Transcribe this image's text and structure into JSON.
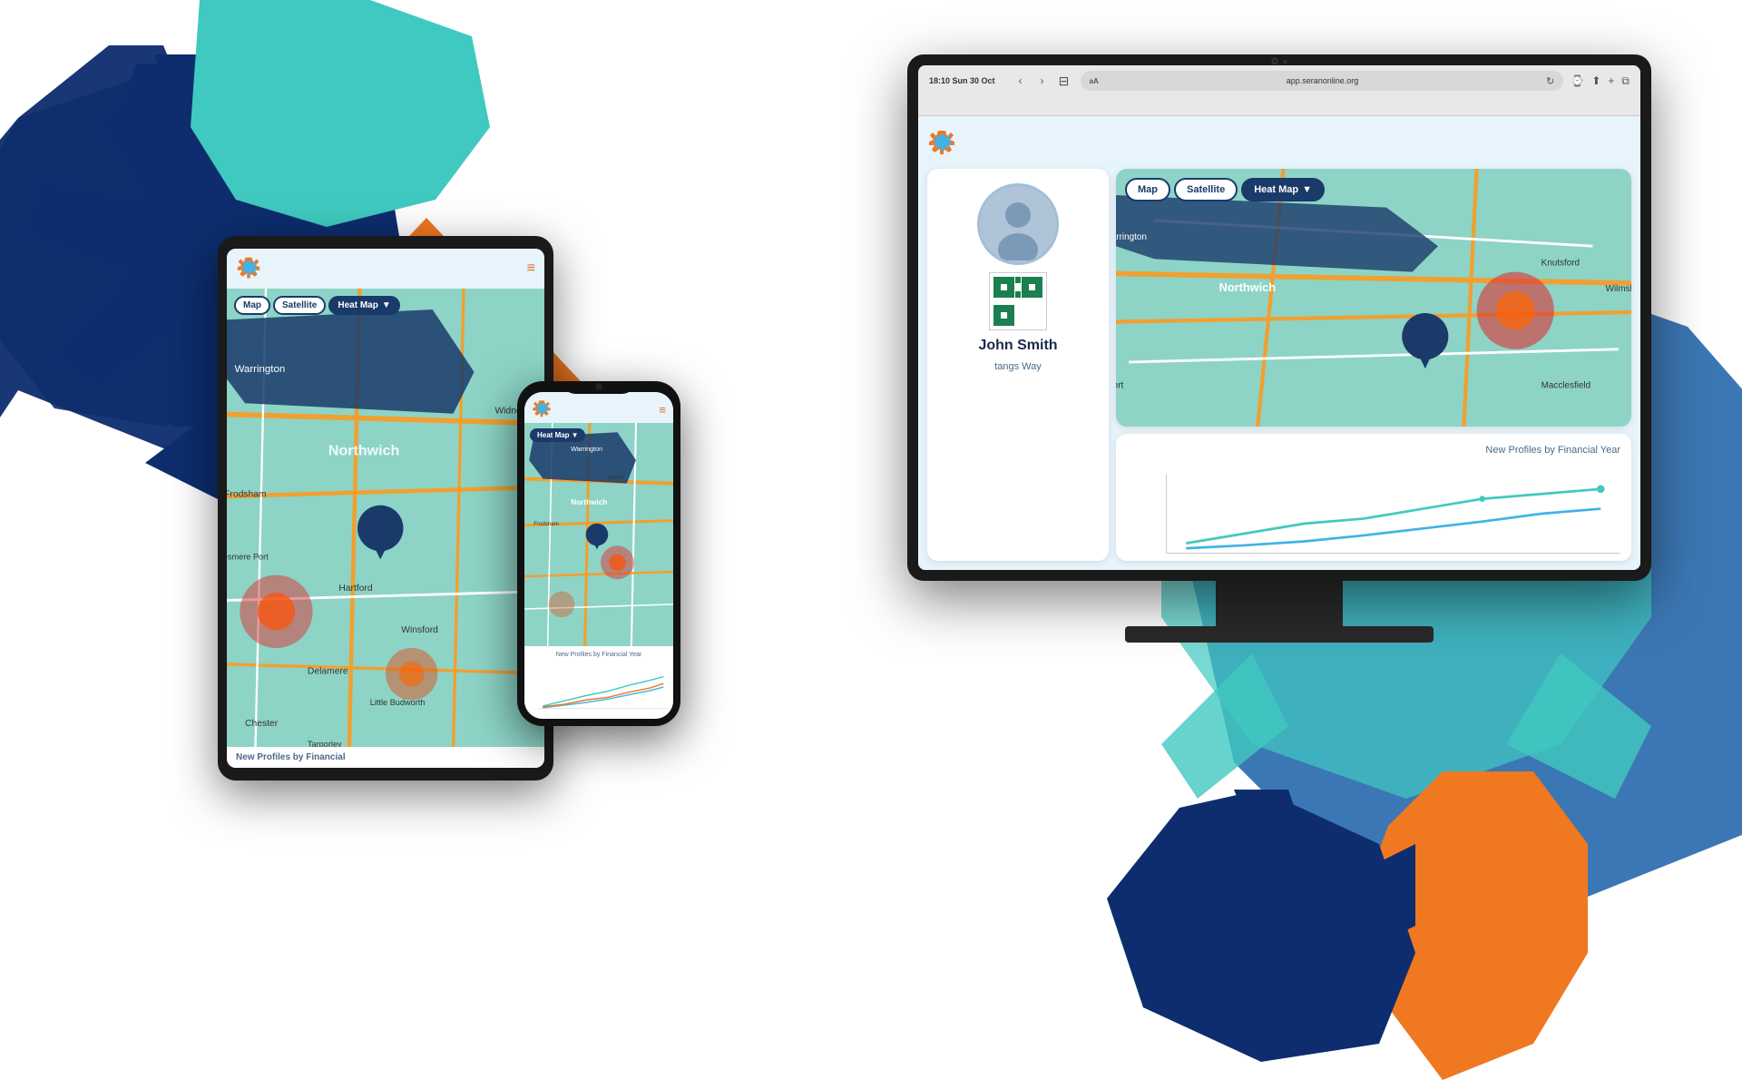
{
  "app": {
    "name": "Seran Online",
    "url": "app.seranonline.org",
    "time": "18:10",
    "date": "Sun 30 Oct"
  },
  "browser": {
    "url": "app.seranonline.org",
    "time_label": "18:10 Sun 30 Oct",
    "aa_label": "aA",
    "reload_symbol": "↻",
    "nav_back": "‹",
    "nav_forward": "›",
    "reader_icon": "□"
  },
  "profile": {
    "name": "John Smith",
    "address": "tangs Way"
  },
  "map": {
    "btn_map": "Map",
    "btn_satellite": "Satellite",
    "btn_heatmap": "Heat Map",
    "dropdown_arrow": "▼"
  },
  "chart": {
    "title": "New Profiles by Financial Year"
  },
  "tablet": {
    "menu_icon": "≡",
    "chart_footer": "New Profiles by Financial"
  },
  "phone": {
    "menu_icon": "≡",
    "heatmap_label": "Heat Map",
    "dropdown_arrow": "▼",
    "chart_title": "New Profiles by Financial Year"
  },
  "colors": {
    "dark_blue": "#0d2d6e",
    "medium_blue": "#1a5fa8",
    "light_blue": "#3fb3e8",
    "teal": "#40c9c0",
    "orange": "#f07820",
    "map_teal": "#8dd4c7",
    "map_road_orange": "#f0a030",
    "map_road_white": "#ffffff",
    "heat_red": "#e03020",
    "heat_orange": "#f08040"
  }
}
